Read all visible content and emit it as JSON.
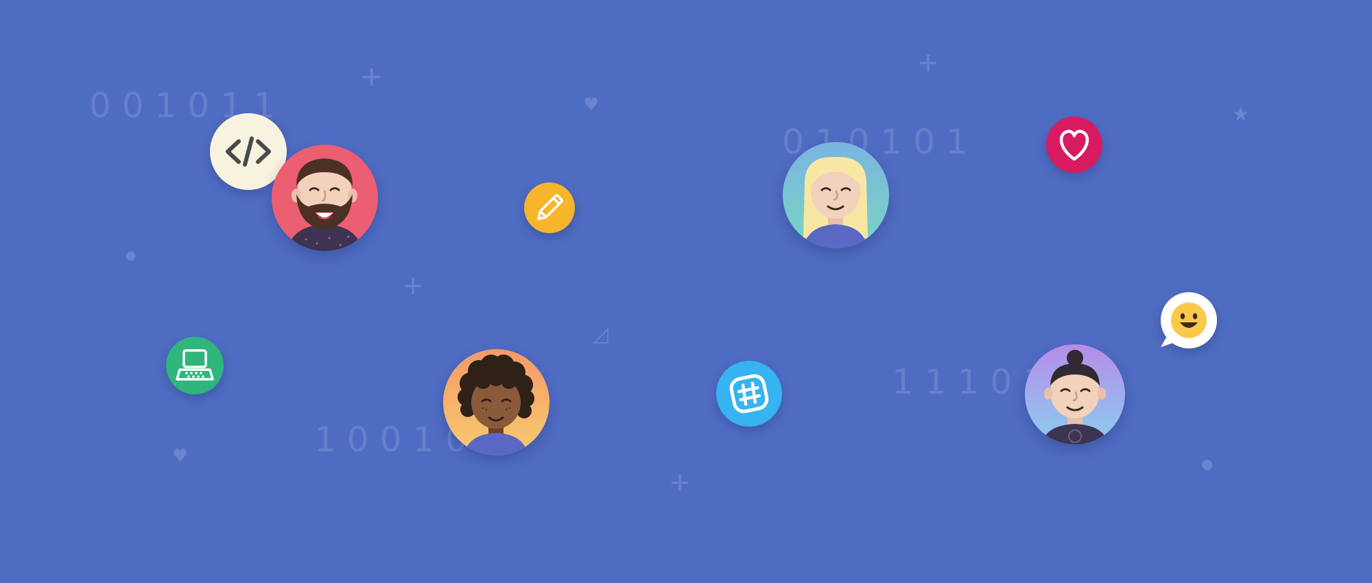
{
  "background": {
    "color": "#4f6cc3",
    "decor_color": "#6a84cd"
  },
  "binary_texts": {
    "b1": "001011",
    "b2": "010101",
    "b3": "10010",
    "b4": "11101"
  },
  "decorations": {
    "plus": "+",
    "heart": "♥",
    "star": "★",
    "dot": "●",
    "triangle": "◿"
  },
  "icons": {
    "code": {
      "name": "code-icon",
      "color": "#f8f3df",
      "glyph": "</>"
    },
    "pencil": {
      "name": "pencil-icon",
      "color": "#f7b52c"
    },
    "heart": {
      "name": "heart-icon",
      "color": "#d81b60"
    },
    "laptop": {
      "name": "laptop-icon",
      "color": "#2eb67d"
    },
    "slack": {
      "name": "slack-hash-icon",
      "color": "#36b3f0"
    },
    "smile": {
      "name": "smile-emoji-icon",
      "color": "#ffffff"
    }
  },
  "avatars": [
    {
      "name": "bearded-man-avatar",
      "bg": "#ec5e72"
    },
    {
      "name": "blonde-woman-avatar",
      "bg": "#77c9c7"
    },
    {
      "name": "curly-hair-avatar",
      "bg": "#f6a86a"
    },
    {
      "name": "bun-hair-avatar",
      "bg": "#a08be6"
    }
  ]
}
